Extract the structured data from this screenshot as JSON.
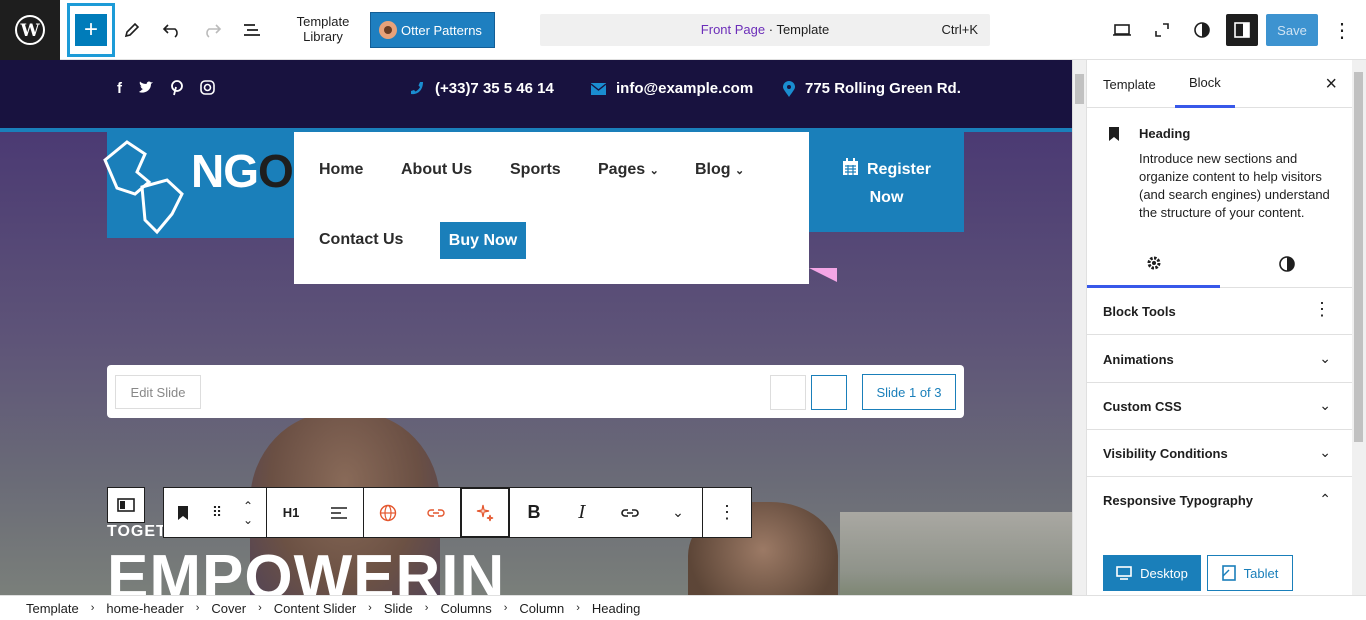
{
  "topbar": {
    "template_library": "Template Library",
    "otter_patterns": "Otter Patterns",
    "command": {
      "page": "Front Page",
      "sep": " · ",
      "kind": "Template",
      "shortcut": "Ctrl+K"
    },
    "save": "Save"
  },
  "canvas": {
    "phone": "(+33)7 35 5 46 14",
    "email": "info@example.com",
    "address": "775 Rolling Green Rd.",
    "logo_n": "NG",
    "logo_o": "O",
    "nav": [
      "Home",
      "About Us",
      "Sports",
      "Pages",
      "Blog",
      "Contact Us"
    ],
    "buy_now": "Buy Now",
    "register_1": "Register",
    "register_2": "Now",
    "edit_slide": "Edit Slide",
    "slide_count": "Slide 1 of 3",
    "heading_level": "H1",
    "eyebrow": "TOGET",
    "heading": "EMPOWERIN"
  },
  "sidebar": {
    "tabs": [
      "Template",
      "Block"
    ],
    "block_name": "Heading",
    "block_desc": "Introduce new sections and organize content to help visitors (and search engines) understand the structure of your content.",
    "panels": [
      "Block Tools",
      "Animations",
      "Custom CSS",
      "Visibility Conditions",
      "Responsive Typography"
    ],
    "resp_desktop": "Desktop",
    "resp_tablet": "Tablet"
  },
  "breadcrumbs": [
    "Template",
    "home-header",
    "Cover",
    "Content Slider",
    "Slide",
    "Columns",
    "Column",
    "Heading"
  ],
  "colors": {
    "accent": "#007cba",
    "brand_blue": "#1a7fba",
    "navy": "#18123f",
    "purple": "#6c2eb9"
  }
}
